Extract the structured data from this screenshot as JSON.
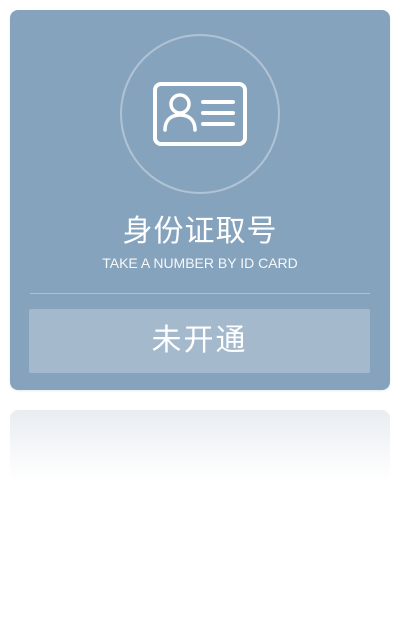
{
  "card": {
    "title": "身份证取号",
    "subtitle": "TAKE A NUMBER BY ID CARD",
    "button_label": "未开通",
    "icon": "id-card-icon",
    "colors": {
      "card_background": "#86a3bd",
      "button_background": "#a4b9cc",
      "text": "#ffffff"
    }
  }
}
